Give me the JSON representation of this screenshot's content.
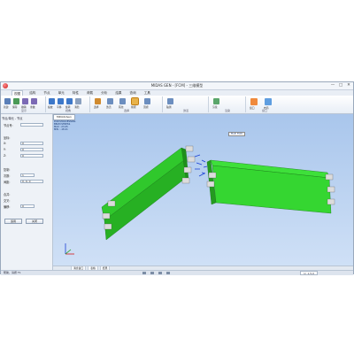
{
  "window": {
    "title": "MIDAS GEN - [FCM] - 三维模型",
    "controls": [
      "—",
      "□",
      "✕"
    ]
  },
  "menu_tabs": [
    "视图",
    "结构",
    "节点",
    "单元",
    "特性",
    "荷载",
    "分析",
    "结果",
    "查询",
    "工具"
  ],
  "ribbon": {
    "groups": [
      {
        "label": "显示"
      },
      {
        "label": "视角"
      },
      {
        "label": "选择"
      },
      {
        "label": "激活"
      },
      {
        "label": "渲染"
      },
      {
        "label": "窗口"
      }
    ],
    "items": [
      "新建",
      "保存",
      "撤销",
      "重做",
      "缩放",
      "平移",
      "旋转",
      "消隐",
      "选择",
      "激活",
      "钝化",
      "前视",
      "顶视",
      "轴测",
      "渲染",
      "窗口",
      "布局"
    ]
  },
  "left_panel": {
    "title": "节点/单元 - 节点",
    "rows": [
      {
        "label": "节点号:",
        "value": ""
      },
      {
        "label": "坐标:",
        "value": ""
      },
      {
        "label": "X:",
        "value": "0"
      },
      {
        "label": "Y:",
        "value": "0"
      },
      {
        "label": "Z:",
        "value": "0"
      },
      {
        "label": "复制:",
        "value": ""
      },
      {
        "label": "次数:",
        "value": "1"
      },
      {
        "label": "间距:",
        "value": "0, 0, 0"
      },
      {
        "label": "合并:",
        "value": ""
      },
      {
        "label": "交叉:",
        "value": ""
      },
      {
        "label": "偏移:",
        "value": "0"
      }
    ],
    "apply_label": "适用",
    "close_label": "关闭"
  },
  "viewport": {
    "tab_label": "MIDAS/Gen",
    "info_lines": [
      "POST-PROCESSING",
      "BEAM STRESS",
      "MAX : 23.45",
      "MIN : -18.21"
    ],
    "annotation": "FILE: FCM",
    "beam_color": "#2fd12b",
    "background_top": "#a9c6ec"
  },
  "bottom_tabs": [
    "消息窗口",
    "表格",
    "结果"
  ],
  "status": {
    "text": "帮助，请按 F1",
    "coord": "U: 1,5,0"
  }
}
